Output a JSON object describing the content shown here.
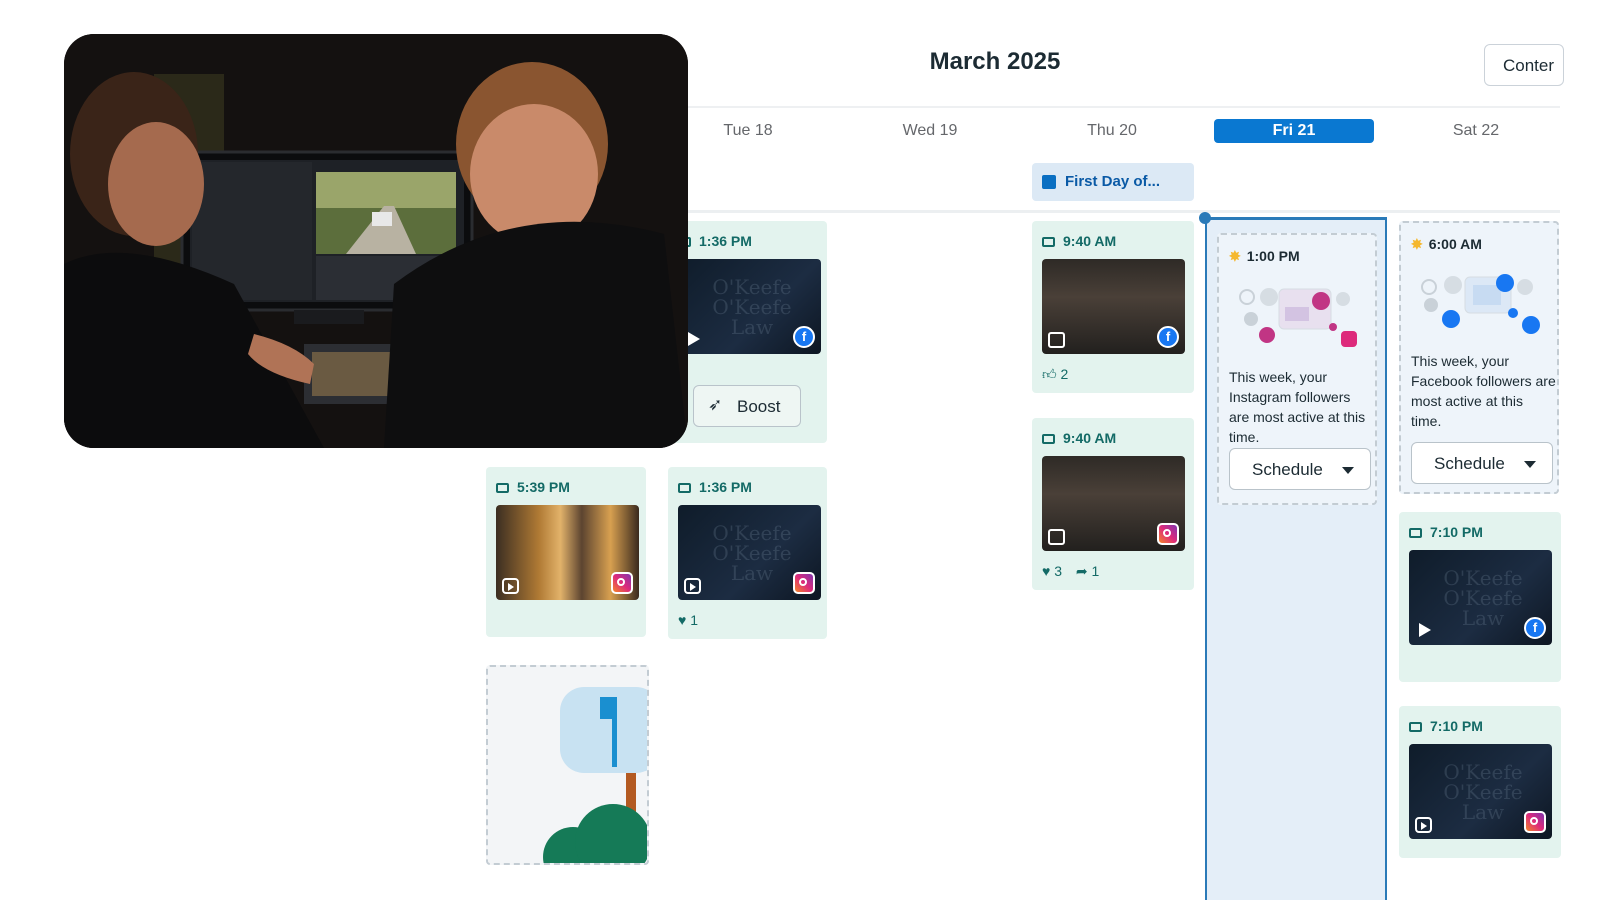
{
  "calendar": {
    "month_title": "March 2025",
    "content_button": "Conter",
    "days": [
      {
        "label": "Tue 18",
        "active": false
      },
      {
        "label": "Wed 19",
        "active": false
      },
      {
        "label": "Thu 20",
        "active": false
      },
      {
        "label": "Fri 21",
        "active": true
      },
      {
        "label": "Sat 22",
        "active": false
      }
    ],
    "event_chip": "First Day of..."
  },
  "posts": {
    "tue_reel": {
      "time": "1:36 PM",
      "watermark": "O'Keefe O'Keefe Law",
      "boost_label": "Boost"
    },
    "mon_beer": {
      "time": "5:39 PM"
    },
    "tue_ig": {
      "time": "1:36 PM",
      "likes": "1",
      "watermark": "O'Keefe O'Keefe Law"
    },
    "thu_fb": {
      "time": "9:40 AM",
      "likes": "2"
    },
    "thu_ig": {
      "time": "9:40 AM",
      "likes": "3",
      "shares": "1"
    },
    "sat_fb": {
      "time": "7:10 PM",
      "watermark": "O'Keefe O'Keefe Law"
    },
    "sat_ig": {
      "time": "7:10 PM",
      "watermark": "O'Keefe O'Keefe Law"
    }
  },
  "suggestions": {
    "fri": {
      "time": "1:00 PM",
      "text": "This week, your Instagram followers are most active at this time.",
      "button": "Schedule"
    },
    "sat": {
      "time": "6:00 AM",
      "text": "This week, your Facebook followers are most active at this time.",
      "button": "Schedule"
    }
  },
  "colors": {
    "accent": "#0a78d1",
    "post_card": "#e3f3ee",
    "post_time": "#136a66",
    "friday_column": "#e4eef8"
  },
  "icons": {
    "facebook": "facebook-icon",
    "instagram": "instagram-icon",
    "like": "thumbs-up-icon",
    "heart": "heart-icon",
    "share": "share-icon",
    "rocket": "rocket-icon",
    "star": "sparkle-icon"
  }
}
